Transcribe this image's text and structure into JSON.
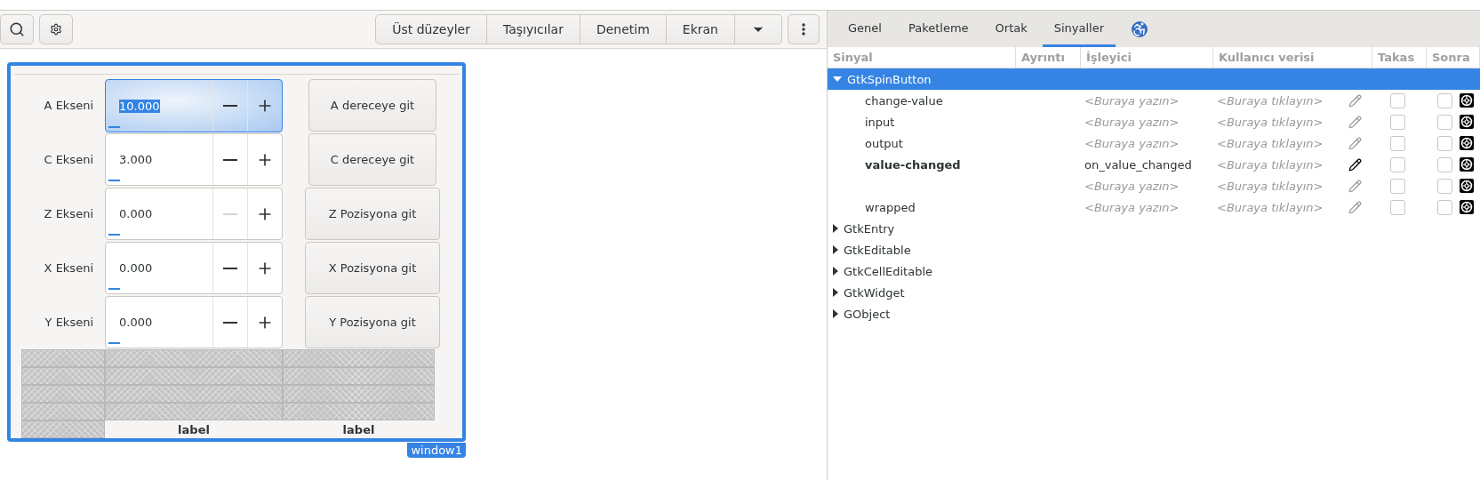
{
  "toolbar": {
    "group_buttons": [
      "Üst düzeyler",
      "Taşıyıcılar",
      "Denetim",
      "Ekran"
    ]
  },
  "designer": {
    "window_title": "window1",
    "rows": [
      {
        "label": "A Ekseni",
        "value": "10.000",
        "focused": true,
        "minus_disabled": false,
        "button": "A dereceye git"
      },
      {
        "label": "C Ekseni",
        "value": "3.000",
        "focused": false,
        "minus_disabled": false,
        "button": "C dereceye git"
      },
      {
        "label": "Z Ekseni",
        "value": "0.000",
        "focused": false,
        "minus_disabled": true,
        "button": "Z Pozisyona git"
      },
      {
        "label": "X Ekseni",
        "value": "0.000",
        "focused": false,
        "minus_disabled": false,
        "button": "X Pozisyona git"
      },
      {
        "label": "Y Ekseni",
        "value": "0.000",
        "focused": false,
        "minus_disabled": false,
        "button": "Y Pozisyona git"
      }
    ],
    "bottom_labels": [
      "label",
      "label"
    ]
  },
  "inspector": {
    "tabs": [
      {
        "label": "Genel",
        "selected": false
      },
      {
        "label": "Paketleme",
        "selected": false
      },
      {
        "label": "Ortak",
        "selected": false
      },
      {
        "label": "Sinyaller",
        "selected": true
      }
    ],
    "columns": [
      "Sinyal",
      "Ayrıntı",
      "İşleyici",
      "Kullanıcı verisi",
      "Takas",
      "Sonra"
    ],
    "groups": [
      {
        "name": "GtkSpinButton",
        "expanded": true,
        "selected": true,
        "signals": [
          {
            "name": "change-value",
            "handler_placeholder": "<Buraya yazın>",
            "user_data_placeholder": "<Buraya tıklayın>",
            "connected": false,
            "swap": false,
            "after": false
          },
          {
            "name": "input",
            "handler_placeholder": "<Buraya yazın>",
            "user_data_placeholder": "<Buraya tıklayın>",
            "connected": false,
            "swap": false,
            "after": false
          },
          {
            "name": "output",
            "handler_placeholder": "<Buraya yazın>",
            "user_data_placeholder": "<Buraya tıklayın>",
            "connected": false,
            "swap": false,
            "after": false
          },
          {
            "name": "value-changed",
            "handler": "on_value_changed",
            "user_data_placeholder": "<Buraya tıklayın>",
            "connected": true,
            "swap": false,
            "after": false
          },
          {
            "handler_placeholder": "<Buraya yazın>",
            "user_data_placeholder": "<Buraya tıklayın>",
            "connected": false,
            "swap": false,
            "after": false
          },
          {
            "name": "wrapped",
            "handler_placeholder": "<Buraya yazın>",
            "user_data_placeholder": "<Buraya tıklayın>",
            "connected": false,
            "swap": false,
            "after": false
          }
        ]
      },
      {
        "name": "GtkEntry",
        "expanded": false,
        "selected": false
      },
      {
        "name": "GtkEditable",
        "expanded": false,
        "selected": false
      },
      {
        "name": "GtkCellEditable",
        "expanded": false,
        "selected": false
      },
      {
        "name": "GtkWidget",
        "expanded": false,
        "selected": false
      },
      {
        "name": "GObject",
        "expanded": false,
        "selected": false
      }
    ]
  }
}
